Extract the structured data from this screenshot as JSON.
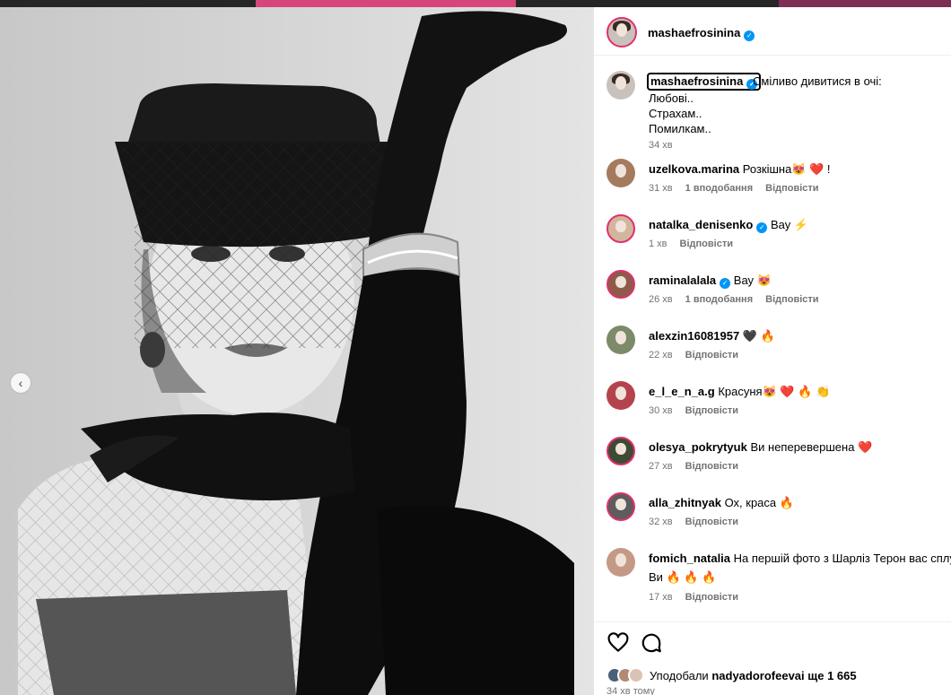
{
  "header": {
    "username": "mashaefrosinina"
  },
  "caption": {
    "username": "mashaefrosinina",
    "first_line": "Сміливо дивитися в очі:",
    "lines": [
      "Любові..",
      "Страхам..",
      "Помилкам.."
    ],
    "time": "34 хв"
  },
  "comments": [
    {
      "username": "uzelkova.marina",
      "verified": false,
      "text": "Розкішна😻 ❤️ !",
      "time": "31 хв",
      "likes": "1 вподобання",
      "reply": "Відповісти"
    },
    {
      "username": "natalka_denisenko",
      "verified": true,
      "text": "Вау ⚡",
      "time": "1 хв",
      "likes": "",
      "reply": "Відповісти"
    },
    {
      "username": "raminalalala",
      "verified": true,
      "text": "Вау 😻",
      "time": "26 хв",
      "likes": "1 вподобання",
      "reply": "Відповісти"
    },
    {
      "username": "alexzin16081957",
      "verified": false,
      "text": "🖤 🔥",
      "time": "22 хв",
      "likes": "",
      "reply": "Відповісти"
    },
    {
      "username": "e_l_e_n_a.g",
      "verified": false,
      "text": "Красуня😻 ❤️ 🔥 👏",
      "time": "30 хв",
      "likes": "",
      "reply": "Відповісти"
    },
    {
      "username": "olesya_pokrytyuk",
      "verified": false,
      "text": "Ви неперевершена ❤️",
      "time": "27 хв",
      "likes": "",
      "reply": "Відповісти"
    },
    {
      "username": "alla_zhitnyak",
      "verified": false,
      "text": "Ох, краса 🔥",
      "time": "32 хв",
      "likes": "",
      "reply": "Відповісти"
    },
    {
      "username": "fomich_natalia",
      "verified": false,
      "text": "На першій фото з Шарліз Терон вас сплу",
      "text2": "Ви 🔥 🔥 🔥",
      "time": "17 хв",
      "likes": "",
      "reply": "Відповісти"
    }
  ],
  "likes": {
    "prefix": "Уподобали ",
    "user": "nadyadorofeeva",
    "suffix": " і ще 1 665"
  },
  "post_time": "34 хв тому",
  "icons": {
    "like": "heart-icon",
    "comment": "comment-icon",
    "prev": "chevron-left-icon",
    "verified": "verified-badge-icon"
  },
  "colors": {
    "verified": "#0095f6",
    "story_ring": "#e1306c",
    "muted": "#737373"
  }
}
